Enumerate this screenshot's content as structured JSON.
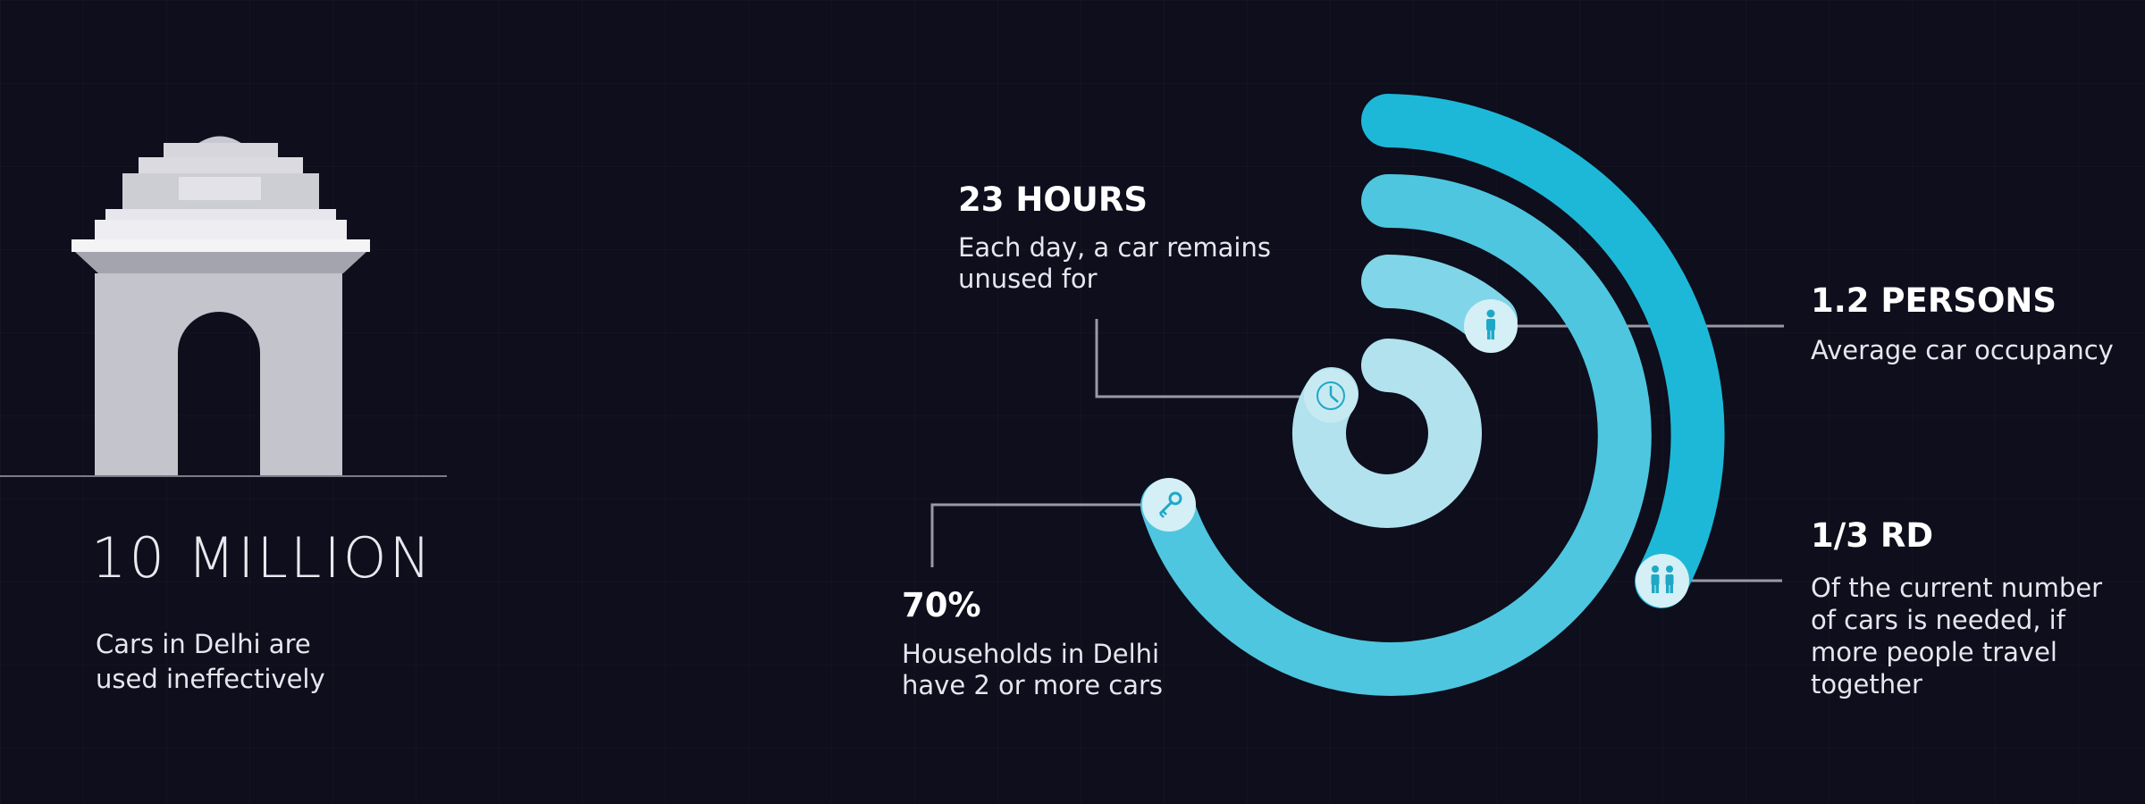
{
  "left_panel": {
    "headline": "10 MILLION",
    "caption_line1": "Cars in Delhi are",
    "caption_line2": "used ineffectively",
    "illustration": "india-gate-icon"
  },
  "stats": {
    "hours": {
      "title": "23 HOURS",
      "caption_line1": "Each day, a car remains",
      "caption_line2": "unused for",
      "icon": "clock-icon"
    },
    "persons": {
      "title": "1.2 PERSONS",
      "caption": "Average car occupancy",
      "icon": "person-icon"
    },
    "rd": {
      "title": "1/3 RD",
      "caption_line1": "Of the current number",
      "caption_line2": "of cars is needed, if",
      "caption_line3": "more people travel",
      "caption_line4": "together",
      "icon": "two-persons-icon"
    },
    "households": {
      "title": "70%",
      "caption_line1": "Households in Delhi",
      "caption_line2": "have 2 or more cars",
      "icon": "key-icon"
    }
  },
  "colors": {
    "background": "#0e0e1c",
    "ring_outer": "#1db8d8",
    "ring_second": "#4ec6df",
    "ring_third": "#80d6e8",
    "ring_inner": "#b2e2ee",
    "gate": "#c4c4cc"
  }
}
